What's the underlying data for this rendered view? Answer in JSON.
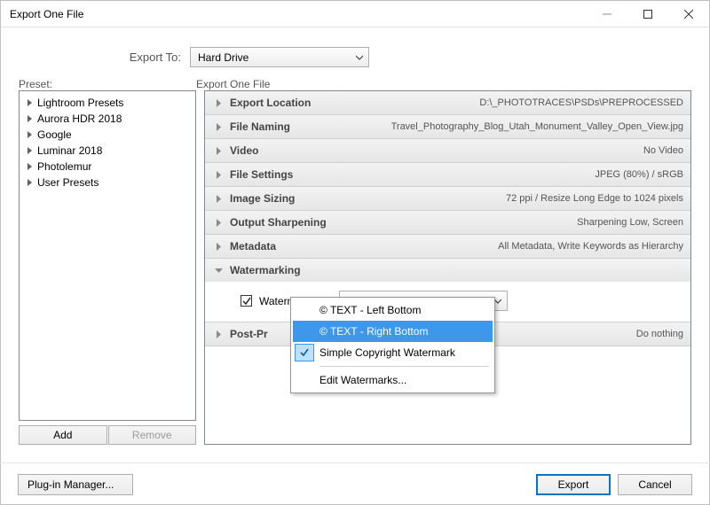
{
  "window": {
    "title": "Export One File"
  },
  "exportTo": {
    "label": "Export To:",
    "value": "Hard Drive"
  },
  "labels": {
    "preset": "Preset:",
    "main": "Export One File"
  },
  "presets": {
    "items": [
      {
        "label": "Lightroom Presets"
      },
      {
        "label": "Aurora HDR 2018"
      },
      {
        "label": "Google"
      },
      {
        "label": "Luminar 2018"
      },
      {
        "label": "Photolemur"
      },
      {
        "label": "User Presets"
      }
    ],
    "add": "Add",
    "remove": "Remove"
  },
  "sections": [
    {
      "name": "Export Location",
      "summary": "D:\\_PHOTOTRACES\\PSDs\\PREPROCESSED"
    },
    {
      "name": "File Naming",
      "summary": "Travel_Photography_Blog_Utah_Monument_Valley_Open_View.jpg"
    },
    {
      "name": "Video",
      "summary": "No Video"
    },
    {
      "name": "File Settings",
      "summary": "JPEG (80%) / sRGB"
    },
    {
      "name": "Image Sizing",
      "summary": "72 ppi / Resize Long Edge to 1024 pixels"
    },
    {
      "name": "Output Sharpening",
      "summary": "Sharpening Low, Screen"
    },
    {
      "name": "Metadata",
      "summary": "All Metadata, Write Keywords as Hierarchy"
    }
  ],
  "watermark": {
    "section": "Watermarking",
    "checkboxLabel": "Watermark:",
    "selected": "Simple Copyright Watermark",
    "options": {
      "o1": "© TEXT - Left Bottom",
      "o2": "© TEXT - Right Bottom",
      "o3": "Simple Copyright Watermark",
      "edit": "Edit Watermarks..."
    }
  },
  "postprocess": {
    "name": "Post-Pr",
    "summary": "Do nothing"
  },
  "footer": {
    "plugin": "Plug-in Manager...",
    "export": "Export",
    "cancel": "Cancel"
  }
}
